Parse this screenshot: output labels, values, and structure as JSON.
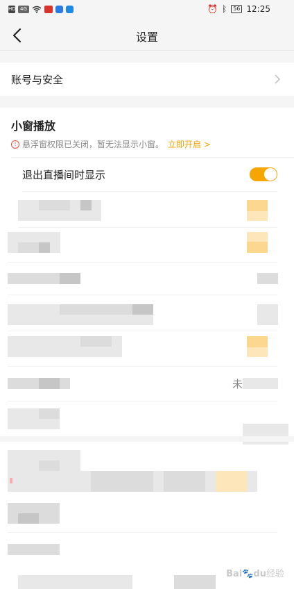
{
  "status_bar": {
    "left_icons": [
      "hd-icon",
      "signal-4g-icon",
      "wifi-icon",
      "app-notification-icon",
      "app-notification-icon",
      "app-notification-icon"
    ],
    "right_icons": [
      "alarm-icon",
      "bluetooth-icon"
    ],
    "battery": "56",
    "time": "12:25"
  },
  "header": {
    "title": "设置"
  },
  "account_row": {
    "label": "账号与安全"
  },
  "mini_window": {
    "title": "小窗播放",
    "notice_text": "悬浮窗权限已关闭，暂无法显示小窗。",
    "notice_link": "立即开启 >",
    "toggle_label": "退出直播间时显示",
    "toggle_on": true
  },
  "partial_text": {
    "unbound_fragment": "未"
  },
  "watermark": {
    "brand": "Bai",
    "brand2": "du",
    "text": "经验"
  },
  "colors": {
    "accent": "#f7a501",
    "link": "#f5a200",
    "warning": "#e74c3c",
    "background": "#f5f5f5"
  }
}
